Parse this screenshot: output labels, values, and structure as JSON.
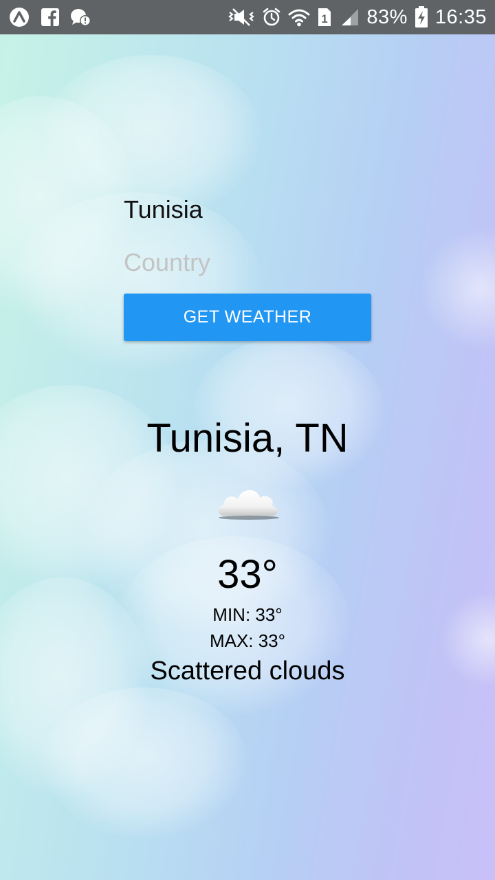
{
  "status_bar": {
    "battery_percent": "83%",
    "time": "16:35",
    "sim_slot": "1",
    "icons": [
      "app-launcher-icon",
      "facebook-icon",
      "messenger-alert-icon",
      "vibrate-icon",
      "alarm-icon",
      "wifi-icon",
      "sim-icon",
      "signal-icon",
      "battery-charging-icon"
    ]
  },
  "form": {
    "city_value": "Tunisia",
    "country_placeholder": "Country",
    "country_value": "",
    "button_label": "GET WEATHER",
    "button_color": "#2196f3"
  },
  "result": {
    "location": "Tunisia, TN",
    "icon": "cloud-icon",
    "temperature": "33°",
    "min": "MIN: 33°",
    "max": "MAX: 33°",
    "description": "Scattered clouds"
  }
}
